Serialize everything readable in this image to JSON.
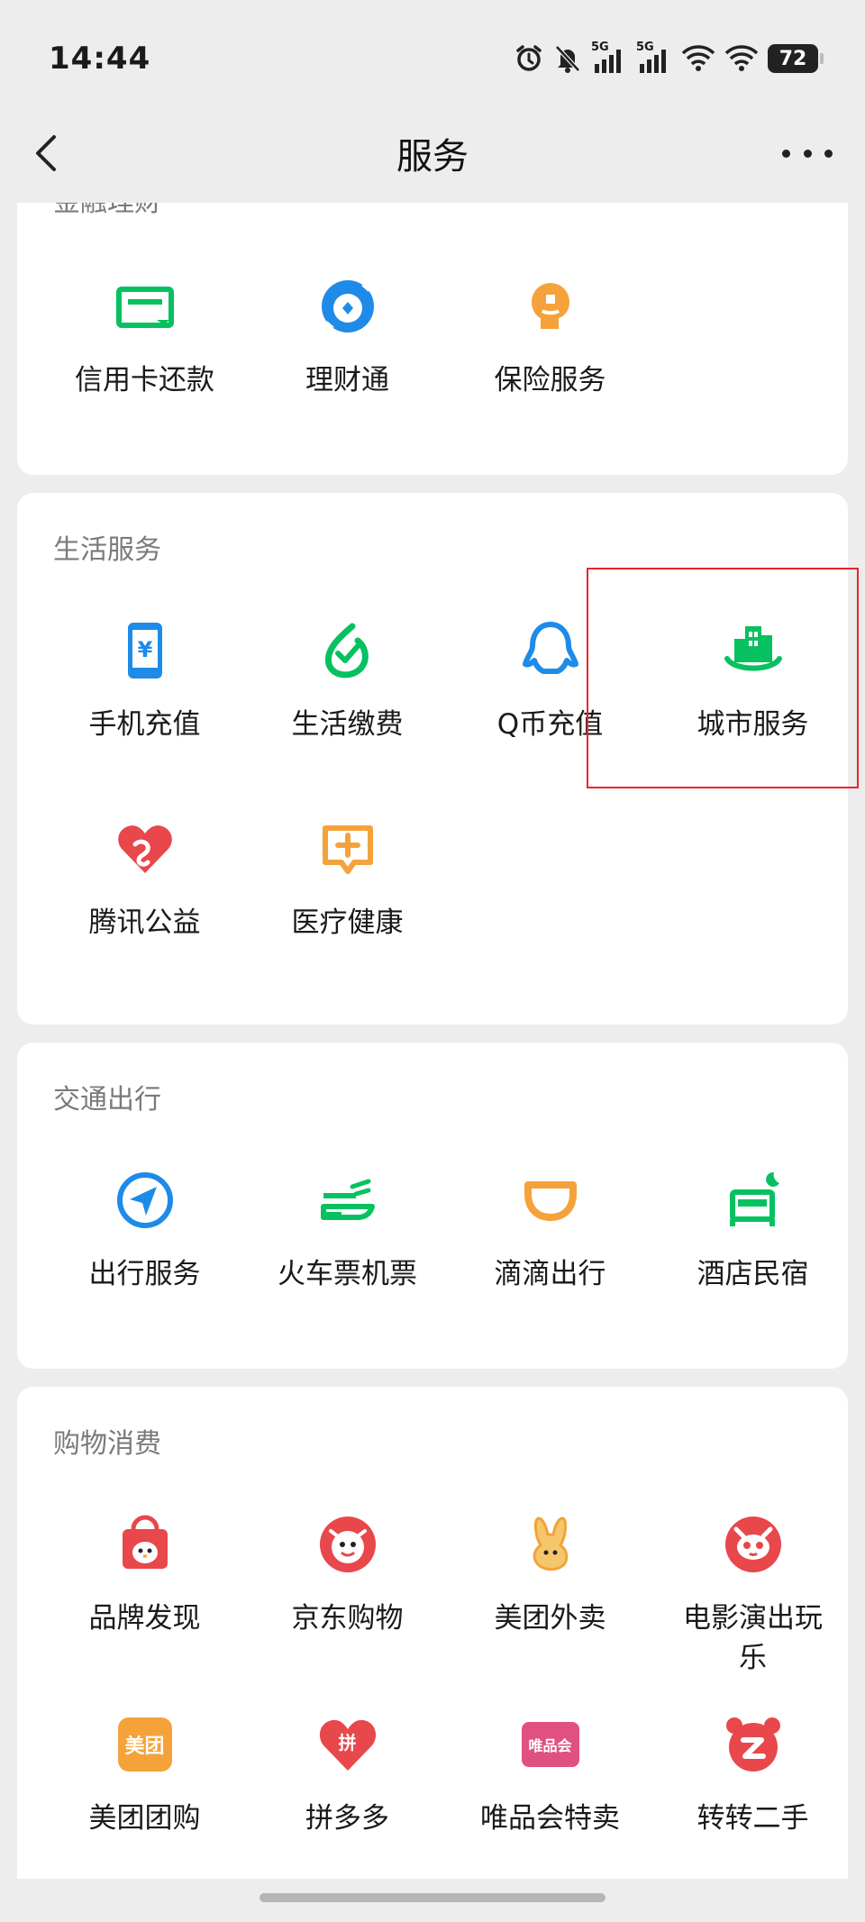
{
  "status_bar": {
    "time": "14:44",
    "network_1": "5G",
    "network_2": "5G",
    "battery": "72"
  },
  "nav": {
    "title": "服务"
  },
  "sections": {
    "finance": {
      "title": "金融理财",
      "items": [
        {
          "label": "信用卡还款",
          "icon": "credit-card-icon"
        },
        {
          "label": "理财通",
          "icon": "wealth-icon"
        },
        {
          "label": "保险服务",
          "icon": "insurance-icon"
        }
      ]
    },
    "life": {
      "title": "生活服务",
      "items": [
        {
          "label": "手机充值",
          "icon": "phone-topup-icon"
        },
        {
          "label": "生活缴费",
          "icon": "utility-payment-icon"
        },
        {
          "label": "Q币充值",
          "icon": "qq-coin-icon"
        },
        {
          "label": "城市服务",
          "icon": "city-service-icon"
        },
        {
          "label": "腾讯公益",
          "icon": "charity-icon"
        },
        {
          "label": "医疗健康",
          "icon": "medical-icon"
        }
      ]
    },
    "transport": {
      "title": "交通出行",
      "items": [
        {
          "label": "出行服务",
          "icon": "travel-service-icon"
        },
        {
          "label": "火车票机票",
          "icon": "train-plane-ticket-icon"
        },
        {
          "label": "滴滴出行",
          "icon": "didi-icon"
        },
        {
          "label": "酒店民宿",
          "icon": "hotel-icon"
        }
      ]
    },
    "shopping": {
      "title": "购物消费",
      "items": [
        {
          "label": "品牌发现",
          "icon": "brand-discovery-icon"
        },
        {
          "label": "京东购物",
          "icon": "jd-icon"
        },
        {
          "label": "美团外卖",
          "icon": "meituan-delivery-icon"
        },
        {
          "label": "电影演出玩",
          "label2": "乐",
          "icon": "movie-icon"
        },
        {
          "label": "美团团购",
          "icon": "meituan-group-icon",
          "badge": "美团"
        },
        {
          "label": "拼多多",
          "icon": "pinduoduo-icon",
          "badge": "拼"
        },
        {
          "label": "唯品会特卖",
          "icon": "vipshop-icon",
          "badge": "唯品会"
        },
        {
          "label": "转转二手",
          "icon": "zhuanzhuan-icon"
        }
      ]
    }
  },
  "colors": {
    "green": "#07c160",
    "blue": "#1e8be8",
    "orange": "#f5a23a",
    "red": "#e8474c",
    "highlight": "#e8262b"
  }
}
